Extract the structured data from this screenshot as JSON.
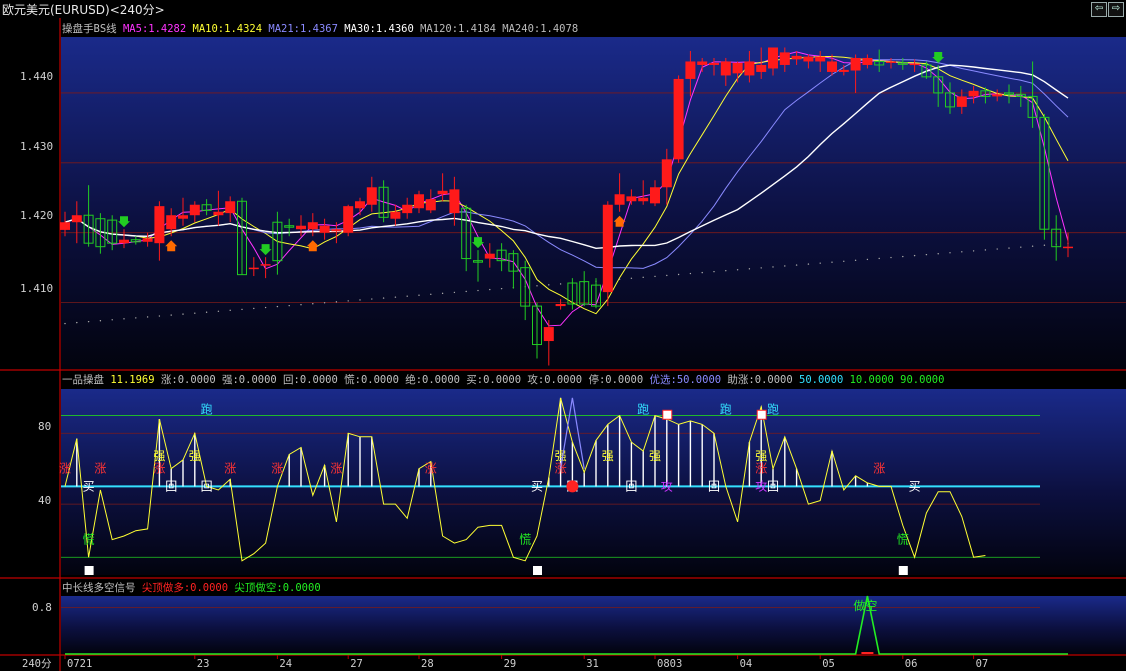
{
  "window": {
    "title": "欧元美元(EURUSD)<240分>",
    "nav_left_glyph": "⇦",
    "nav_right_glyph": "⇨"
  },
  "colors": {
    "up": "#ff1a1a",
    "down": "#22cc22",
    "ma5": "#ff33ff",
    "ma10": "#ffff33",
    "ma21": "#8a8aff",
    "ma30": "#ffffff",
    "ma120": "#bbbbbb",
    "ma240": "#bbbbbb",
    "axis": "#c00000",
    "grid": "#7a1a1a",
    "cyan": "#33e0ff",
    "green_line": "#22cc22"
  },
  "main_panel": {
    "legend": [
      {
        "text": "操盘手BS线",
        "color": "#c0c0c0"
      },
      {
        "text": "MA5:1.4282",
        "color": "#ff33ff"
      },
      {
        "text": "MA10:1.4324",
        "color": "#ffff33"
      },
      {
        "text": "MA21:1.4367",
        "color": "#8a8aff"
      },
      {
        "text": "MA30:1.4360",
        "color": "#ffffff"
      },
      {
        "text": "MA120:1.4184",
        "color": "#bbbbbb"
      },
      {
        "text": "MA240:1.4078",
        "color": "#bbbbbb"
      }
    ],
    "yticks": [
      "1.440",
      "1.430",
      "1.420",
      "1.410"
    ]
  },
  "indicator_panel": {
    "legend": [
      {
        "text": "一品操盘",
        "color": "#c0c0c0"
      },
      {
        "text": "11.1969",
        "color": "#ffff33"
      },
      {
        "text": "涨:0.0000",
        "color": "#c0c0c0"
      },
      {
        "text": "强:0.0000",
        "color": "#c0c0c0"
      },
      {
        "text": "回:0.0000",
        "color": "#c0c0c0"
      },
      {
        "text": "慌:0.0000",
        "color": "#c0c0c0"
      },
      {
        "text": "绝:0.0000",
        "color": "#c0c0c0"
      },
      {
        "text": "买:0.0000",
        "color": "#c0c0c0"
      },
      {
        "text": "攻:0.0000",
        "color": "#c0c0c0"
      },
      {
        "text": "停:0.0000",
        "color": "#c0c0c0"
      },
      {
        "text": "优选:50.0000",
        "color": "#8a8aff"
      },
      {
        "text": "助涨:0.0000",
        "color": "#c0c0c0"
      },
      {
        "text": "50.0000",
        "color": "#33e0ff"
      },
      {
        "text": "10.0000",
        "color": "#22ee22"
      },
      {
        "text": "90.0000",
        "color": "#22ee22"
      }
    ],
    "yticks": [
      "80",
      "40"
    ],
    "signal_labels": {
      "rise": "涨",
      "strong": "强",
      "back": "回",
      "panic": "慌",
      "buy": "买",
      "attack": "攻",
      "run": "跑"
    }
  },
  "signal_panel": {
    "legend": [
      {
        "text": "中长线多空信号",
        "color": "#c0c0c0"
      },
      {
        "text": "尖顶做多:0.0000",
        "color": "#ff2222"
      },
      {
        "text": "尖顶做空:0.0000",
        "color": "#22ee22"
      }
    ],
    "ytick": "0.8",
    "short_label": "做空"
  },
  "x_axis": {
    "period_label": "240分",
    "ticks": [
      "0721",
      "23",
      "24",
      "27",
      "28",
      "29",
      "31",
      "0803",
      "04",
      "05",
      "06",
      "07"
    ]
  },
  "chart_data": {
    "type": "candlestick",
    "title": "欧元美元(EURUSD)<240分>",
    "ylim": [
      1.4005,
      1.448
    ],
    "candles": [
      {
        "o": 1.4204,
        "h": 1.423,
        "l": 1.4195,
        "c": 1.4215
      },
      {
        "o": 1.4215,
        "h": 1.4245,
        "l": 1.4185,
        "c": 1.4225
      },
      {
        "o": 1.4225,
        "h": 1.4268,
        "l": 1.418,
        "c": 1.4185
      },
      {
        "o": 1.422,
        "h": 1.4228,
        "l": 1.417,
        "c": 1.418
      },
      {
        "o": 1.4218,
        "h": 1.4225,
        "l": 1.4175,
        "c": 1.4185
      },
      {
        "o": 1.4185,
        "h": 1.4205,
        "l": 1.4178,
        "c": 1.419
      },
      {
        "o": 1.419,
        "h": 1.4195,
        "l": 1.4183,
        "c": 1.4187
      },
      {
        "o": 1.4187,
        "h": 1.42,
        "l": 1.418,
        "c": 1.4192
      },
      {
        "o": 1.4185,
        "h": 1.4245,
        "l": 1.416,
        "c": 1.4238
      },
      {
        "o": 1.4205,
        "h": 1.4235,
        "l": 1.4195,
        "c": 1.4225
      },
      {
        "o": 1.422,
        "h": 1.425,
        "l": 1.421,
        "c": 1.4225
      },
      {
        "o": 1.4225,
        "h": 1.4245,
        "l": 1.4215,
        "c": 1.424
      },
      {
        "o": 1.424,
        "h": 1.4248,
        "l": 1.4225,
        "c": 1.4232
      },
      {
        "o": 1.4225,
        "h": 1.426,
        "l": 1.421,
        "c": 1.423
      },
      {
        "o": 1.4228,
        "h": 1.4252,
        "l": 1.4215,
        "c": 1.4245
      },
      {
        "o": 1.4245,
        "h": 1.425,
        "l": 1.414,
        "c": 1.414
      },
      {
        "o": 1.415,
        "h": 1.4165,
        "l": 1.4138,
        "c": 1.415
      },
      {
        "o": 1.4155,
        "h": 1.4165,
        "l": 1.4135,
        "c": 1.4155
      },
      {
        "o": 1.4215,
        "h": 1.423,
        "l": 1.414,
        "c": 1.416
      },
      {
        "o": 1.421,
        "h": 1.422,
        "l": 1.4195,
        "c": 1.4208
      },
      {
        "o": 1.4205,
        "h": 1.4225,
        "l": 1.4195,
        "c": 1.421
      },
      {
        "o": 1.4205,
        "h": 1.4228,
        "l": 1.4195,
        "c": 1.4215
      },
      {
        "o": 1.42,
        "h": 1.422,
        "l": 1.419,
        "c": 1.421
      },
      {
        "o": 1.4202,
        "h": 1.4215,
        "l": 1.4185,
        "c": 1.4205
      },
      {
        "o": 1.42,
        "h": 1.424,
        "l": 1.4195,
        "c": 1.4238
      },
      {
        "o": 1.4235,
        "h": 1.425,
        "l": 1.4225,
        "c": 1.4245
      },
      {
        "o": 1.424,
        "h": 1.428,
        "l": 1.423,
        "c": 1.4265
      },
      {
        "o": 1.4265,
        "h": 1.4275,
        "l": 1.4215,
        "c": 1.4222
      },
      {
        "o": 1.422,
        "h": 1.424,
        "l": 1.421,
        "c": 1.423
      },
      {
        "o": 1.4228,
        "h": 1.425,
        "l": 1.422,
        "c": 1.424
      },
      {
        "o": 1.4235,
        "h": 1.426,
        "l": 1.4228,
        "c": 1.4255
      },
      {
        "o": 1.4232,
        "h": 1.4262,
        "l": 1.4228,
        "c": 1.4248
      },
      {
        "o": 1.4255,
        "h": 1.4285,
        "l": 1.4245,
        "c": 1.426
      },
      {
        "o": 1.4228,
        "h": 1.428,
        "l": 1.421,
        "c": 1.4262
      },
      {
        "o": 1.4235,
        "h": 1.424,
        "l": 1.4145,
        "c": 1.4163
      },
      {
        "o": 1.416,
        "h": 1.4175,
        "l": 1.413,
        "c": 1.4158
      },
      {
        "o": 1.4163,
        "h": 1.4185,
        "l": 1.415,
        "c": 1.417
      },
      {
        "o": 1.4175,
        "h": 1.4185,
        "l": 1.4145,
        "c": 1.416
      },
      {
        "o": 1.417,
        "h": 1.4175,
        "l": 1.412,
        "c": 1.4145
      },
      {
        "o": 1.415,
        "h": 1.416,
        "l": 1.4075,
        "c": 1.4095
      },
      {
        "o": 1.4095,
        "h": 1.41,
        "l": 1.402,
        "c": 1.404
      },
      {
        "o": 1.4045,
        "h": 1.4075,
        "l": 1.401,
        "c": 1.4065
      },
      {
        "o": 1.4095,
        "h": 1.4105,
        "l": 1.409,
        "c": 1.4098
      },
      {
        "o": 1.4128,
        "h": 1.4135,
        "l": 1.409,
        "c": 1.4098
      },
      {
        "o": 1.413,
        "h": 1.4145,
        "l": 1.4095,
        "c": 1.4098
      },
      {
        "o": 1.4125,
        "h": 1.4135,
        "l": 1.4092,
        "c": 1.4095
      },
      {
        "o": 1.4115,
        "h": 1.4245,
        "l": 1.4095,
        "c": 1.424
      },
      {
        "o": 1.424,
        "h": 1.4285,
        "l": 1.423,
        "c": 1.4255
      },
      {
        "o": 1.4245,
        "h": 1.4262,
        "l": 1.424,
        "c": 1.4252
      },
      {
        "o": 1.4245,
        "h": 1.4275,
        "l": 1.424,
        "c": 1.425
      },
      {
        "o": 1.4242,
        "h": 1.4275,
        "l": 1.4238,
        "c": 1.4265
      },
      {
        "o": 1.4265,
        "h": 1.432,
        "l": 1.424,
        "c": 1.4305
      },
      {
        "o": 1.4305,
        "h": 1.4425,
        "l": 1.43,
        "c": 1.442
      },
      {
        "o": 1.442,
        "h": 1.446,
        "l": 1.4395,
        "c": 1.4445
      },
      {
        "o": 1.444,
        "h": 1.445,
        "l": 1.443,
        "c": 1.4445
      },
      {
        "o": 1.444,
        "h": 1.445,
        "l": 1.4425,
        "c": 1.4443
      },
      {
        "o": 1.4425,
        "h": 1.445,
        "l": 1.441,
        "c": 1.4445
      },
      {
        "o": 1.4428,
        "h": 1.4445,
        "l": 1.4415,
        "c": 1.4443
      },
      {
        "o": 1.4425,
        "h": 1.446,
        "l": 1.4415,
        "c": 1.4445
      },
      {
        "o": 1.443,
        "h": 1.4465,
        "l": 1.442,
        "c": 1.444
      },
      {
        "o": 1.4435,
        "h": 1.445,
        "l": 1.4425,
        "c": 1.4465
      },
      {
        "o": 1.444,
        "h": 1.4465,
        "l": 1.443,
        "c": 1.4458
      },
      {
        "o": 1.4448,
        "h": 1.446,
        "l": 1.444,
        "c": 1.4453
      },
      {
        "o": 1.4445,
        "h": 1.4455,
        "l": 1.4435,
        "c": 1.4452
      },
      {
        "o": 1.4445,
        "h": 1.446,
        "l": 1.443,
        "c": 1.4452
      },
      {
        "o": 1.443,
        "h": 1.4455,
        "l": 1.4425,
        "c": 1.4445
      },
      {
        "o": 1.443,
        "h": 1.444,
        "l": 1.4425,
        "c": 1.4433
      },
      {
        "o": 1.4432,
        "h": 1.4455,
        "l": 1.44,
        "c": 1.445
      },
      {
        "o": 1.444,
        "h": 1.4455,
        "l": 1.4435,
        "c": 1.445
      },
      {
        "o": 1.4445,
        "h": 1.4462,
        "l": 1.443,
        "c": 1.444
      },
      {
        "o": 1.4443,
        "h": 1.445,
        "l": 1.4435,
        "c": 1.4445
      },
      {
        "o": 1.4443,
        "h": 1.445,
        "l": 1.4433,
        "c": 1.4442
      },
      {
        "o": 1.444,
        "h": 1.4448,
        "l": 1.443,
        "c": 1.4442
      },
      {
        "o": 1.444,
        "h": 1.4445,
        "l": 1.442,
        "c": 1.4423
      },
      {
        "o": 1.4423,
        "h": 1.444,
        "l": 1.438,
        "c": 1.44
      },
      {
        "o": 1.44,
        "h": 1.4415,
        "l": 1.437,
        "c": 1.438
      },
      {
        "o": 1.438,
        "h": 1.4405,
        "l": 1.437,
        "c": 1.4395
      },
      {
        "o": 1.4395,
        "h": 1.441,
        "l": 1.4385,
        "c": 1.4403
      },
      {
        "o": 1.4403,
        "h": 1.4408,
        "l": 1.4385,
        "c": 1.4395
      },
      {
        "o": 1.4395,
        "h": 1.4405,
        "l": 1.4388,
        "c": 1.4398
      },
      {
        "o": 1.44,
        "h": 1.4412,
        "l": 1.4385,
        "c": 1.4398
      },
      {
        "o": 1.4398,
        "h": 1.441,
        "l": 1.438,
        "c": 1.4395
      },
      {
        "o": 1.4395,
        "h": 1.4445,
        "l": 1.435,
        "c": 1.4365
      },
      {
        "o": 1.4365,
        "h": 1.437,
        "l": 1.419,
        "c": 1.4205
      },
      {
        "o": 1.4205,
        "h": 1.4225,
        "l": 1.416,
        "c": 1.418
      },
      {
        "o": 1.418,
        "h": 1.42,
        "l": 1.4165,
        "c": 1.418
      }
    ],
    "indicator": {
      "ylim": [
        0,
        105
      ],
      "h_lines": [
        50,
        10,
        90
      ],
      "values": [
        50,
        77,
        10,
        48,
        20,
        22,
        25,
        26,
        88,
        60,
        65,
        80,
        50,
        48,
        54,
        8,
        12,
        18,
        50,
        68,
        72,
        45,
        62,
        30,
        80,
        78,
        78,
        40,
        40,
        32,
        60,
        64,
        22,
        18,
        20,
        27,
        28,
        28,
        10,
        8,
        22,
        55,
        100,
        75,
        58,
        76,
        85,
        90,
        75,
        70,
        90,
        88,
        85,
        87,
        85,
        80,
        50,
        30,
        75,
        95,
        60,
        78,
        60,
        40,
        42,
        70,
        48,
        56,
        52,
        50,
        50,
        28,
        10,
        35,
        47,
        47,
        33,
        10,
        11
      ]
    },
    "signal": {
      "ylim": [
        0,
        1.0
      ],
      "values": [
        0,
        0,
        0,
        0,
        0,
        0,
        0,
        0,
        0,
        0,
        0,
        0,
        0,
        0,
        0,
        0,
        0,
        0,
        0,
        0,
        0,
        0,
        0,
        0,
        0,
        0,
        0,
        0,
        0,
        0,
        0,
        0,
        0,
        0,
        0,
        0,
        0,
        0,
        0,
        0,
        0,
        0,
        0,
        0,
        0,
        0,
        0,
        0,
        0,
        0,
        0,
        0,
        0,
        0,
        0,
        0,
        0,
        0,
        0,
        0,
        0,
        0,
        0,
        0,
        0,
        0,
        0,
        0,
        1,
        0,
        0,
        0,
        0,
        0,
        0,
        0,
        0,
        0,
        0,
        0,
        0,
        0,
        0,
        0,
        0,
        0
      ]
    }
  }
}
